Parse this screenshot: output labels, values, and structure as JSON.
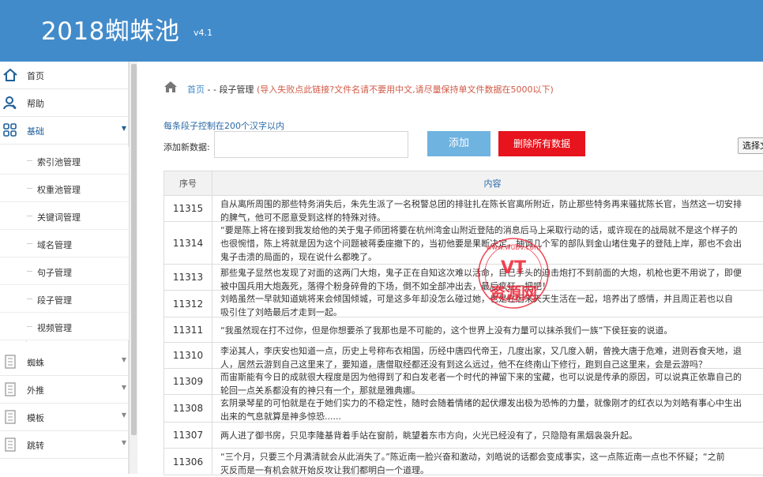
{
  "app": {
    "title": "2018蜘蛛池",
    "version": "v4.1"
  },
  "sidebar": {
    "items": [
      {
        "label": "首页",
        "icon": "home-icon"
      },
      {
        "label": "帮助",
        "icon": "user-icon"
      },
      {
        "label": "基础",
        "icon": "grid-icon"
      }
    ],
    "subitems": [
      "索引池管理",
      "权重池管理",
      "关键词管理",
      "域名管理",
      "句子管理",
      "段子管理",
      "视频管理"
    ],
    "groups": [
      {
        "label": "蜘蛛",
        "icon": "doc-icon"
      },
      {
        "label": "外推",
        "icon": "doc-icon"
      },
      {
        "label": "模板",
        "icon": "doc-icon"
      },
      {
        "label": "跳转",
        "icon": "doc-icon"
      }
    ]
  },
  "breadcrumb": {
    "home": "首页",
    "sep": " - - ",
    "current": "段子管理",
    "warning": "(导入失败点此链接?文件名请不要用中文,请尽量保持单文件数据在5000以下)"
  },
  "form": {
    "hint": "每条段子控制在200个汉字以内",
    "add_label": "添加新数据:",
    "input_value": "",
    "add_button": "添加",
    "delete_all_button": "删除所有数据",
    "file_button": "选择文"
  },
  "table": {
    "headers": [
      "序号",
      "内容"
    ],
    "rows": [
      {
        "id": "11315",
        "lines": [
          "自从离所周围的那些特务消失后，朱先生派了一名税警总团的排驻扎在陈长官离所附近，防止那些特务再来骚扰陈长官，当然这一切安排",
          "的脾气，他可不愿意受到这样的特殊对待。"
        ]
      },
      {
        "id": "11314",
        "lines": [
          "“要是陈上将在接到我发给他的关于鬼子师团将要在杭州湾金山附近登陆的消息后马上采取行动的话，或许现在的战局就不是这个样子的",
          "也很惋惜，陈上将就是因为这个问题被蒋委座撤下的，当初他要是果断决定，抽调几个军的部队到金山堵住鬼子的登陆上岸，那也不会出",
          "鬼子击溃的局面的，现在说什么都晚了。"
        ]
      },
      {
        "id": "11313",
        "lines": [
          "那些鬼子显然也发现了对面的这两门大炮，鬼子正在自知这次难以活命，自己手头的迫击炮打不到前面的大炮，机枪也更不用说了，即便",
          "被中国兵用大炮轰死，落得个粉身碎骨的下场，倒不如全部冲出去，最后疯狂一把吧！"
        ]
      },
      {
        "id": "11312",
        "lines": [
          "刘皓虽然一早就知道姚将来会倾国倾城，可是这多年却没怎么碰过她，也是在后来天天生活在一起，培养出了感情，并且周正若也以自",
          "吸引住了刘皓最后才走到一起。"
        ]
      },
      {
        "id": "11311",
        "lines": [
          "“我虽然现在打不过你，但是你想要杀了我那也是不可能的，这个世界上没有力量可以抹杀我们一族”下侯狂妄的说道。"
        ]
      },
      {
        "id": "11310",
        "lines": [
          "李泌其人，李庆安也知道一点，历史上号称布衣相国，历经中唐四代帝王，几度出家，又几度入朝，曾挽大唐于危难，进则吞食天地，退",
          "人，居然云游到自己这里来了，要知道，唐僧取经都还没有到这么远过，他不在终南山下修行，跑到自己这里来，会是云游吗？"
        ]
      },
      {
        "id": "11309",
        "lines": [
          "而宙斯能有今日的成就很大程度是因为他得到了和白发老者一个时代的神留下来的宝藏，也可以说是传承的原因，可以说真正依靠自己的",
          "轮回一点关系都没有的神只有一个，那就是雅典娜。"
        ]
      },
      {
        "id": "11308",
        "lines": [
          "玄阴录琴星的可怕就是在于她们实力的不稳定性，随时会随着情绪的起伏爆发出极为恐怖的力量，就像刚才的红衣以为刘皓有事心中生出",
          "出来的气息就算是神多惊恐......"
        ]
      },
      {
        "id": "11307",
        "lines": [
          "两人进了御书房，只见李隆基背着手站在窗前，眺望着东市方向，火光已经没有了，只隐隐有黑烟袅袅升起。"
        ]
      },
      {
        "id": "11306",
        "lines": [
          "“三个月，只要三个月满清就会从此消失了。”陈近南一脸兴奋和激动，刘皓说的话都会变成事实，这一点陈近南一点也不怀疑；“之前",
          "灭反而是一有机会就开始反攻让我们都明白一个道理。"
        ]
      }
    ]
  },
  "watermark": {
    "url": "www.wubv.com",
    "title": "资源网",
    "tag": "VT"
  },
  "colors": {
    "header": "#428bca",
    "danger": "#e7131d",
    "primary": "#6fb3e0",
    "link": "#428bca",
    "warning": "#d15b47"
  }
}
